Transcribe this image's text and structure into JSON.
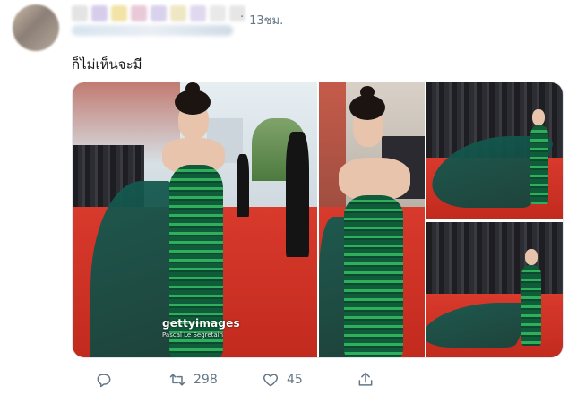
{
  "tweet": {
    "timestamp": "13ชม.",
    "separator": "·",
    "text": "ก็ไม่เห็นจะมี"
  },
  "media": {
    "watermark_brand": "gettyimages",
    "watermark_credit": "Pascal Le Segretain"
  },
  "actions": {
    "reply_icon": "reply-icon",
    "retweet_icon": "retweet-icon",
    "retweet_count": "298",
    "like_icon": "heart-icon",
    "like_count": "45",
    "share_icon": "share-icon"
  },
  "colors": {
    "meta_gray": "#657786",
    "red_carpet": "#d83a2c",
    "gown_green": "#1f7a4a"
  }
}
